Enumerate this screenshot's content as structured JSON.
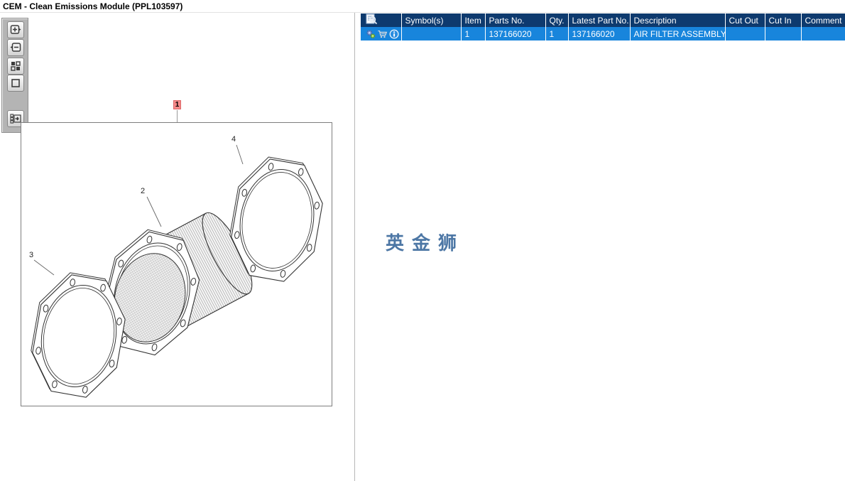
{
  "window": {
    "title": "CEM - Clean Emissions Module (PPL103597)"
  },
  "toolbar": {
    "items": [
      {
        "name": "zoom-in"
      },
      {
        "name": "zoom-out"
      },
      {
        "name": "fit-view"
      },
      {
        "name": "zoom-selection"
      },
      {
        "name": "toggle-parts-list"
      }
    ]
  },
  "diagram": {
    "callouts": {
      "part1": "1",
      "part2": "2",
      "part3": "3",
      "part4": "4"
    },
    "callout_highlight_bg": "#f48a8a"
  },
  "watermark": {
    "text": "英金狮",
    "color": "#4d77a5"
  },
  "parts_table": {
    "header_bg": "#0e3a6e",
    "selected_row_bg": "#1885dc",
    "header_icon": "parts-search-icon",
    "row_icons": [
      "options-gears-icon",
      "cart-icon",
      "info-icon"
    ],
    "columns": [
      "",
      "Symbol(s)",
      "Item",
      "Parts No.",
      "Qty.",
      "Latest Part No.",
      "Description",
      "Cut Out",
      "Cut In",
      "Comment"
    ],
    "rows": [
      {
        "symbols": "",
        "item": "1",
        "parts_no": "137166020",
        "qty": "1",
        "latest_part_no": "137166020",
        "description": "AIR FILTER ASSEMBLY",
        "cut_out": "",
        "cut_in": "",
        "comment": ""
      }
    ]
  }
}
